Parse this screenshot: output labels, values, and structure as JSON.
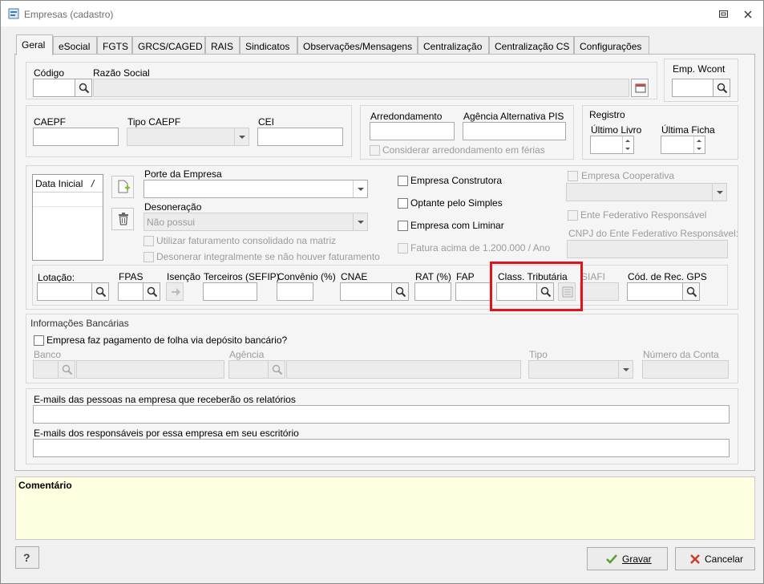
{
  "window": {
    "title": "Empresas (cadastro)"
  },
  "tabs": [
    "Geral",
    "eSocial",
    "FGTS",
    "GRCS/CAGED",
    "RAIS",
    "Sindicatos",
    "Observações/Mensagens",
    "Centralização",
    "Centralização CS",
    "Configurações"
  ],
  "identificacao": {
    "codigo_label": "Código",
    "razao_social_label": "Razão Social",
    "emp_wcont_label": "Emp. Wcont"
  },
  "caepf": {
    "caepf_label": "CAEPF",
    "tipo_caepf_label": "Tipo CAEPF",
    "cei_label": "CEI"
  },
  "arredondamento": {
    "arredondamento_label": "Arredondamento",
    "agencia_label": "Agência Alternativa PIS",
    "considerar_label": "Considerar arredondamento em férias"
  },
  "registro": {
    "title": "Registro",
    "ultimo_livro_label": "Último Livro",
    "ultima_ficha_label": "Última Ficha"
  },
  "grid": {
    "column": "Data Inicial",
    "sort_mark": "/"
  },
  "porte": {
    "porte_label": "Porte da Empresa",
    "desoneracao_label": "Desoneração",
    "desoneracao_value": "Não possui",
    "faturamento_consolidado": "Utilizar faturamento consolidado na matriz",
    "desonerar_integralmente": "Desonerar integralmente se não houver faturamento"
  },
  "flags": {
    "construtora": "Empresa Construtora",
    "simples": "Optante pelo Simples",
    "liminar": "Empresa com Liminar",
    "fatura_acima": "Fatura acima de 1.200.000 / Ano",
    "cooperativa": "Empresa Cooperativa",
    "ente_federativo": "Ente Federativo Responsável",
    "cnpj_ente": "CNPJ do Ente Federativo Responsável:"
  },
  "tributos": {
    "lotacao": "Lotação:",
    "fpas": "FPAS",
    "isencao": "Isenção",
    "terceiros": "Terceiros (SEFIP)",
    "convenio": "Convênio (%)",
    "cnae": "CNAE",
    "rat": "RAT (%)",
    "fap": "FAP",
    "class_tributaria": "Class. Tributária",
    "siafi": "SIAFI",
    "cod_rec_gps": "Cód. de Rec. GPS"
  },
  "bancarias": {
    "title": "Informações Bancárias",
    "deposito": "Empresa faz pagamento de folha via depósito bancário?",
    "banco": "Banco",
    "agencia": "Agência",
    "tipo": "Tipo",
    "numero_conta": "Número da Conta"
  },
  "emails": {
    "relatorios": "E-mails das pessoas na empresa que receberão os relatórios",
    "responsaveis": "E-mails dos responsáveis por essa empresa em seu escritório"
  },
  "comentario": "Comentário",
  "buttons": {
    "help": "?",
    "gravar": "Gravar",
    "cancelar": "Cancelar"
  },
  "colors": {
    "accent_highlight": "#e0141c",
    "comment_bg": "#ffffe1"
  }
}
